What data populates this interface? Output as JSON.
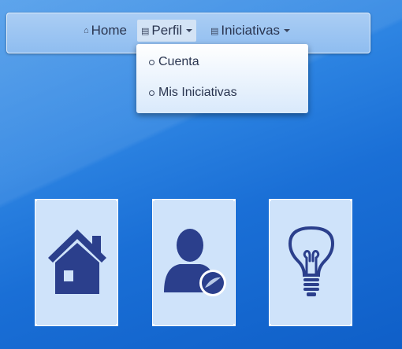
{
  "navbar": {
    "home_label": "Home",
    "perfil_label": "Perfil",
    "iniciativas_label": "Iniciativas"
  },
  "dropdown": {
    "items": [
      "Cuenta",
      "Mis Iniciativas"
    ]
  },
  "tiles": [
    {
      "icon": "house-icon"
    },
    {
      "icon": "user-profile-icon"
    },
    {
      "icon": "lightbulb-icon"
    }
  ],
  "colors": {
    "icon": "#2b3f8c",
    "tile_bg": "#cfe3fa",
    "navbar_bg": "#9fc7f2",
    "background": "#2d84e2"
  }
}
